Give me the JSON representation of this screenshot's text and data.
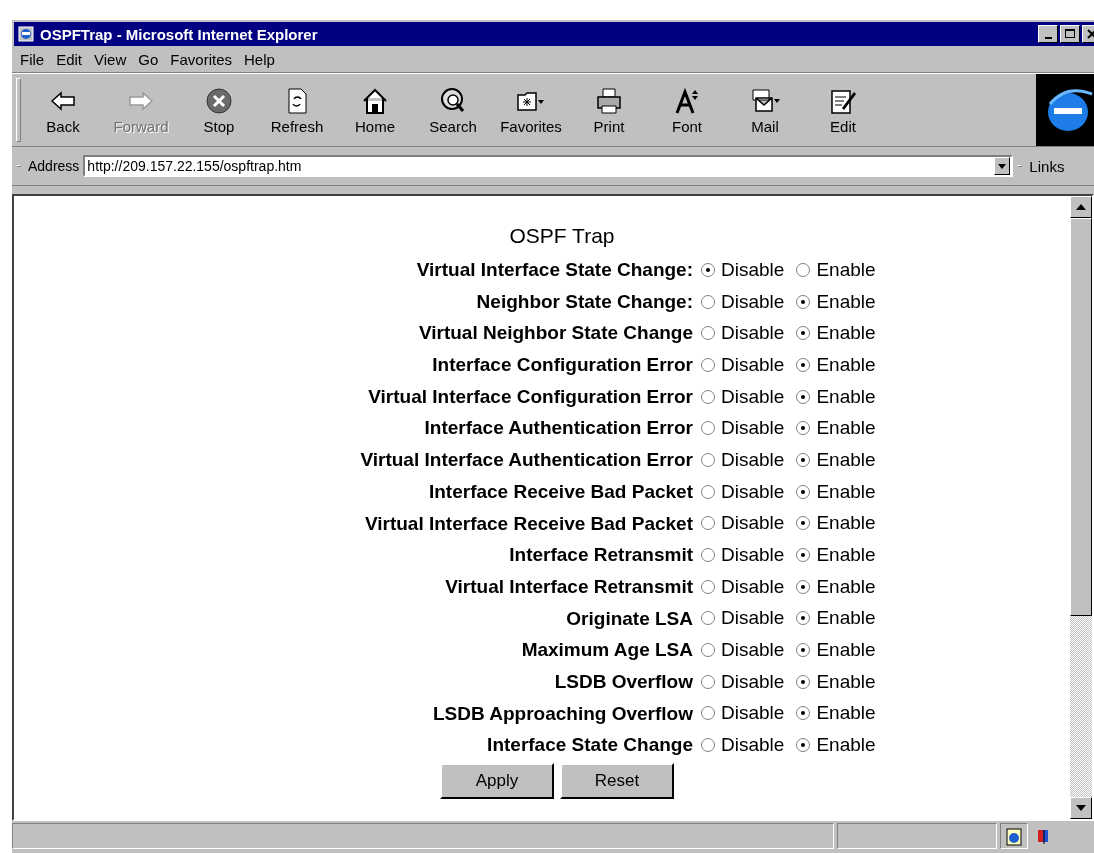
{
  "window": {
    "title": "OSPFTrap - Microsoft Internet Explorer"
  },
  "menu": [
    "File",
    "Edit",
    "View",
    "Go",
    "Favorites",
    "Help"
  ],
  "toolbar": [
    {
      "kind": "back",
      "label": "Back",
      "disabled": false
    },
    {
      "kind": "forward",
      "label": "Forward",
      "disabled": true
    },
    {
      "kind": "stop",
      "label": "Stop",
      "disabled": false
    },
    {
      "kind": "refresh",
      "label": "Refresh",
      "disabled": false
    },
    {
      "kind": "home",
      "label": "Home",
      "disabled": false
    },
    {
      "kind": "search",
      "label": "Search",
      "disabled": false
    },
    {
      "kind": "favorites",
      "label": "Favorites",
      "disabled": false
    },
    {
      "kind": "print",
      "label": "Print",
      "disabled": false
    },
    {
      "kind": "font",
      "label": "Font",
      "disabled": false
    },
    {
      "kind": "mail",
      "label": "Mail",
      "disabled": false
    },
    {
      "kind": "edit",
      "label": "Edit",
      "disabled": false
    }
  ],
  "address_bar": {
    "label": "Address",
    "value": "http://209.157.22.155/ospftrap.htm",
    "links": "Links"
  },
  "page": {
    "heading": "OSPF Trap",
    "rows": [
      {
        "label": "Virtual Interface State Change:",
        "options": [
          {
            "label": "Disable",
            "selected": true
          },
          {
            "label": "Enable",
            "selected": false
          }
        ]
      },
      {
        "label": "Neighbor State Change:",
        "options": [
          {
            "label": "Disable",
            "selected": false
          },
          {
            "label": "Enable",
            "selected": true
          }
        ]
      },
      {
        "label": "Virtual Neighbor State Change",
        "options": [
          {
            "label": "Disable",
            "selected": false
          },
          {
            "label": "Enable",
            "selected": true
          }
        ]
      },
      {
        "label": "Interface Configuration Error",
        "options": [
          {
            "label": "Disable",
            "selected": false
          },
          {
            "label": "Enable",
            "selected": true
          }
        ]
      },
      {
        "label": "Virtual Interface Configuration Error",
        "options": [
          {
            "label": "Disable",
            "selected": false
          },
          {
            "label": "Enable",
            "selected": true
          }
        ]
      },
      {
        "label": "Interface Authentication Error",
        "options": [
          {
            "label": "Disable",
            "selected": false
          },
          {
            "label": "Enable",
            "selected": true
          }
        ]
      },
      {
        "label": "Virtual Interface Authentication Error",
        "options": [
          {
            "label": "Disable",
            "selected": false
          },
          {
            "label": "Enable",
            "selected": true
          }
        ]
      },
      {
        "label": "Interface Receive Bad Packet",
        "options": [
          {
            "label": "Disable",
            "selected": false
          },
          {
            "label": "Enable",
            "selected": true
          }
        ]
      },
      {
        "label": "Virtual Interface Receive Bad Packet",
        "options": [
          {
            "label": "Disable",
            "selected": false
          },
          {
            "label": "Enable",
            "selected": true
          }
        ]
      },
      {
        "label": "Interface Retransmit",
        "options": [
          {
            "label": "Disable",
            "selected": false
          },
          {
            "label": "Enable",
            "selected": true
          }
        ]
      },
      {
        "label": "Virtual Interface Retransmit",
        "options": [
          {
            "label": "Disable",
            "selected": false
          },
          {
            "label": "Enable",
            "selected": true
          }
        ]
      },
      {
        "label": "Originate LSA",
        "options": [
          {
            "label": "Disable",
            "selected": false
          },
          {
            "label": "Enable",
            "selected": true
          }
        ]
      },
      {
        "label": "Maximum Age LSA",
        "options": [
          {
            "label": "Disable",
            "selected": false
          },
          {
            "label": "Enable",
            "selected": true
          }
        ]
      },
      {
        "label": "LSDB Overflow",
        "options": [
          {
            "label": "Disable",
            "selected": false
          },
          {
            "label": "Enable",
            "selected": true
          }
        ]
      },
      {
        "label": "LSDB Approaching Overflow",
        "options": [
          {
            "label": "Disable",
            "selected": false
          },
          {
            "label": "Enable",
            "selected": true
          }
        ]
      },
      {
        "label": "Interface State Change",
        "options": [
          {
            "label": "Disable",
            "selected": false
          },
          {
            "label": "Enable",
            "selected": true
          }
        ]
      }
    ],
    "buttons": [
      "Apply",
      "Reset"
    ]
  }
}
